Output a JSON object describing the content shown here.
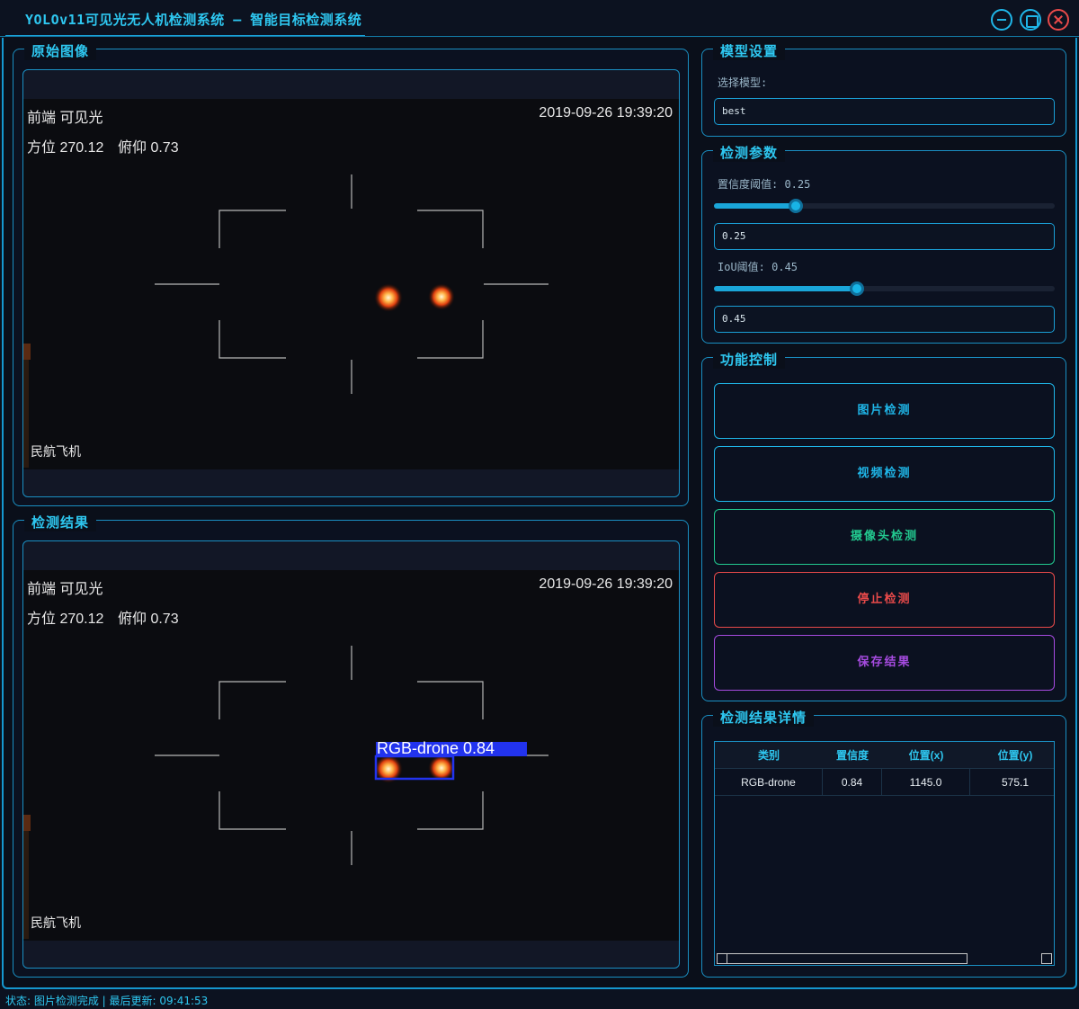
{
  "window": {
    "title": "YOLOv11可见光无人机检测系统 – 智能目标检测系统"
  },
  "original_panel": {
    "title": "原始图像",
    "overlay": {
      "top_left": "前端  可见光",
      "timestamp": "2019-09-26 19:39:20",
      "azimuth": "方位 270.12",
      "pitch": "俯仰 0.73",
      "bottom_left": "民航飞机"
    }
  },
  "result_panel": {
    "title": "检测结果",
    "overlay": {
      "top_left": "前端  可见光",
      "timestamp": "2019-09-26 19:39:20",
      "azimuth": "方位 270.12",
      "pitch": "俯仰 0.73",
      "bottom_left": "民航飞机"
    },
    "detection_label": "RGB-drone  0.84"
  },
  "model_settings": {
    "title": "模型设置",
    "select_label": "选择模型:",
    "selected_model": "best"
  },
  "detection_params": {
    "title": "检测参数",
    "confidence_label": "置信度阈值: 0.25",
    "confidence_value": "0.25",
    "confidence_fraction": 0.25,
    "iou_label": "IoU阈值: 0.45",
    "iou_value": "0.45",
    "iou_fraction": 0.45
  },
  "function_control": {
    "title": "功能控制",
    "buttons": [
      {
        "label": "图片检测",
        "color": "#1fb6e8"
      },
      {
        "label": "视频检测",
        "color": "#1fb6e8"
      },
      {
        "label": "摄像头检测",
        "color": "#22c98f"
      },
      {
        "label": "停止检测",
        "color": "#e84a4a"
      },
      {
        "label": "保存结果",
        "color": "#a64be0"
      }
    ]
  },
  "results_detail": {
    "title": "检测结果详情",
    "columns": [
      "类别",
      "置信度",
      "位置(x)",
      "位置(y)"
    ],
    "rows": [
      [
        "RGB-drone",
        "0.84",
        "1145.0",
        "575.1"
      ]
    ]
  },
  "status_bar": {
    "text": "状态: 图片检测完成 | 最后更新: 09:41:53"
  },
  "colors": {
    "accent": "#1fb6e8",
    "title_text": "#2ec7f0",
    "background": "#0a0f1a",
    "detection_box": "#2233ee"
  }
}
